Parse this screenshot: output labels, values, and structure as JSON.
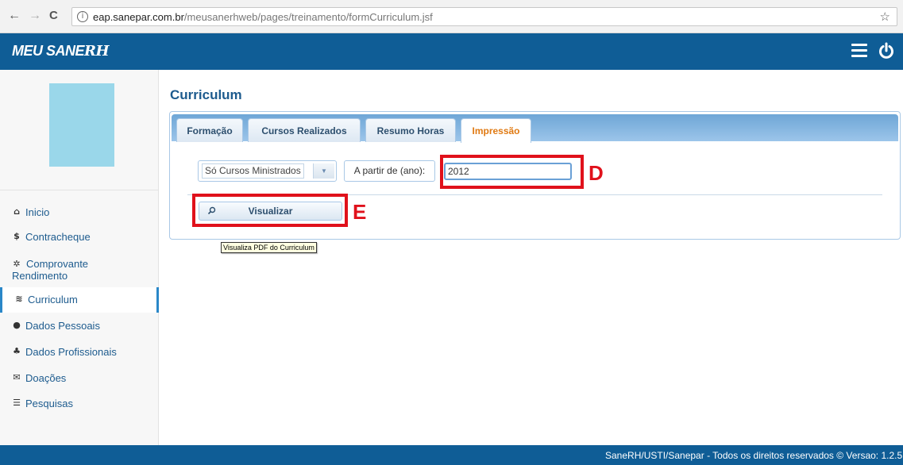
{
  "browser": {
    "back_icon": "←",
    "forward_icon": "→",
    "reload_icon": "C",
    "url_domain": "eap.sanepar.com.br",
    "url_path": "/meusanerhweb/pages/treinamento/formCurriculum.jsf",
    "star_icon": "☆",
    "info_icon": "i"
  },
  "header": {
    "logo_main": "MEU SANE",
    "logo_rh": "RH",
    "menu_icon": "hamburger-icon",
    "power_icon": "power-icon"
  },
  "sidebar": {
    "items": [
      {
        "icon": "⌂",
        "label": "Inicio"
      },
      {
        "icon": "$",
        "label": "Contracheque"
      },
      {
        "icon": "✲",
        "label_line1": "Comprovante",
        "label_line2": "Rendimento"
      },
      {
        "icon": "≋",
        "label": "Curriculum"
      },
      {
        "icon": "●",
        "label": "Dados Pessoais"
      },
      {
        "icon": "♣",
        "label": "Dados Profissionais"
      },
      {
        "icon": "✉",
        "label": "Doações"
      },
      {
        "icon": "☰",
        "label": "Pesquisas"
      }
    ]
  },
  "main": {
    "title": "Curriculum",
    "tabs": [
      {
        "label": "Formação"
      },
      {
        "label": "Cursos Realizados"
      },
      {
        "label": "Resumo Horas"
      },
      {
        "label": "Impressão"
      }
    ],
    "select_value": "Só Cursos Ministrados",
    "select_arrow": "▼",
    "from_label": "A partir de (ano):",
    "year_value": "2012",
    "view_button": "Visualizar",
    "tooltip": "Visualiza PDF do Curriculum"
  },
  "annotations": {
    "d": "D",
    "e": "E"
  },
  "colors": {
    "header_bg": "#0f5d96",
    "active_tab_text": "#e07a13",
    "annotation": "#e0111b",
    "avatar": "#9ad7ea"
  },
  "footer": {
    "text": "SaneRH/USTI/Sanepar - Todos os direitos reservados © Versao: 1.2.5"
  }
}
